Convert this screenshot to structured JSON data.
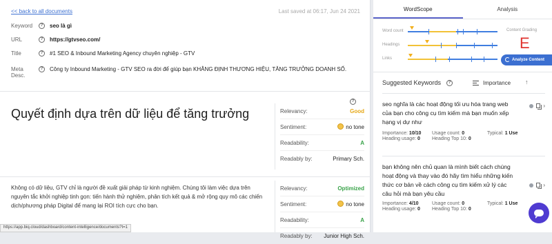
{
  "editor": {
    "back_link": "<< back to all documents",
    "last_saved": "Last saved at 06:17, Jun 24 2021",
    "fields": [
      {
        "label": "Keyword",
        "value": "seo là gì"
      },
      {
        "label": "URL",
        "value": "https://gtvseo.com/"
      },
      {
        "label": "Title",
        "value": "#1 SEO & Inbound Marketing Agency chuyên nghiệp - GTV"
      },
      {
        "label": "Meta Desc.",
        "value": "Công ty Inbound Marketing - GTV SEO ra đời để giúp bạn KHẲNG ĐỊNH THƯƠNG HIỆU, TĂNG TRƯỞNG DOANH SỐ."
      }
    ],
    "heading": "Quyết định dựa trên dữ liệu để tăng trưởng",
    "paragraph": "Không có dữ liệu, GTV chỉ là người đề xuất giải pháp từ kinh nghiệm. Chúng tôi làm việc dựa trên nguyên tắc khởi nghiệp tinh gọn: tiến hành thử nghiệm, phân tích kết quả & mở rộng quy mô các chiến dịch/phương pháp Digital để mang lại ROI tích cực cho bạn.",
    "block1_scores": [
      {
        "label": "Relevancy:",
        "value": "Good"
      },
      {
        "label": "Sentiment:",
        "value": "no tone"
      },
      {
        "label": "Readability:",
        "value": "A"
      },
      {
        "label": "Readably by:",
        "value": "Primary Sch."
      }
    ],
    "block2_scores": [
      {
        "label": "Relevancy:",
        "value": "Optimized"
      },
      {
        "label": "Sentiment:",
        "value": "no tone"
      },
      {
        "label": "Readability:",
        "value": "A"
      },
      {
        "label": "Readably by:",
        "value": "Junior High Sch."
      }
    ],
    "status_url": "https://app.biq.cloud/dashboard/content-intelligence/documents?t=1"
  },
  "panel": {
    "tabs": [
      "WordScope",
      "Analysis"
    ],
    "gauges": [
      "Word count",
      "Headings",
      "Links"
    ],
    "grade_label": "Content Grading",
    "grade": "E",
    "analyze_label": "Analyze Content",
    "suggested_title": "Suggested Keywords",
    "sort_label": "Importance",
    "keywords": [
      {
        "text": "seo nghĩa là các hoạt động tối ưu hóa trang web của bạn cho công cụ tìm kiếm mà bạn muốn xếp hạng vị dự như",
        "importance": "10/10",
        "usage": "0",
        "typical": "1 Use",
        "heading_usage": "0",
        "heading_top10": "0"
      },
      {
        "text": "bạn không nên chủ quan là mình biết cách chúng hoạt động và thay vào đó hãy tìm hiểu những kiến thức cơ bản về cách công cụ tìm kiếm xử lý các câu hỏi mà bạn yêu cầu",
        "importance": "4/10",
        "usage": "0",
        "typical": "1 Use",
        "heading_usage": "0",
        "heading_top10": "0"
      }
    ],
    "stat_labels": {
      "importance": "Importance:",
      "usage": "Usage count:",
      "typical": "Typical:",
      "heading_usage": "Heading usage:",
      "heading_top10": "Heading Top 10:"
    }
  },
  "colors": {
    "accent": "#3b6fd1",
    "good": "#e6a817",
    "optimized": "#3aa34a",
    "grade": "#e0342f",
    "chat": "#4f3bd1"
  }
}
